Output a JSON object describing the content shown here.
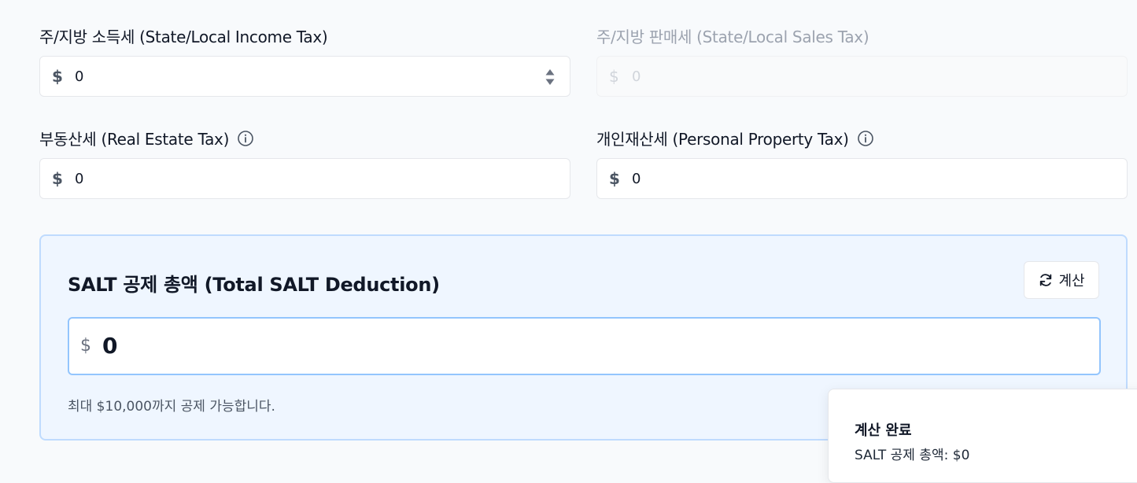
{
  "fields": {
    "state_income": {
      "label": "주/지방 소득세 (State/Local Income Tax)",
      "currency": "$",
      "value": "0",
      "enabled": true
    },
    "state_sales": {
      "label": "주/지방 판매세 (State/Local Sales Tax)",
      "currency": "$",
      "value": "0",
      "enabled": false
    },
    "real_estate": {
      "label": "부동산세 (Real Estate Tax)",
      "currency": "$",
      "value": "0",
      "info_icon": "info-icon"
    },
    "personal_property": {
      "label": "개인재산세 (Personal Property Tax)",
      "currency": "$",
      "value": "0",
      "info_icon": "info-icon"
    }
  },
  "salt": {
    "title": "SALT 공제 총액 (Total SALT Deduction)",
    "calc_button_label": "계산",
    "calc_button_icon": "refresh-icon",
    "currency": "$",
    "total": "0",
    "helper_text": "최대 $10,000까지 공제 가능합니다."
  },
  "toast": {
    "title": "계산 완료",
    "message": "SALT 공제 총액: $0"
  },
  "colors": {
    "card_background": "#eff6ff",
    "card_border": "#bfdbfe",
    "input_focus_border": "#93c5fd"
  }
}
